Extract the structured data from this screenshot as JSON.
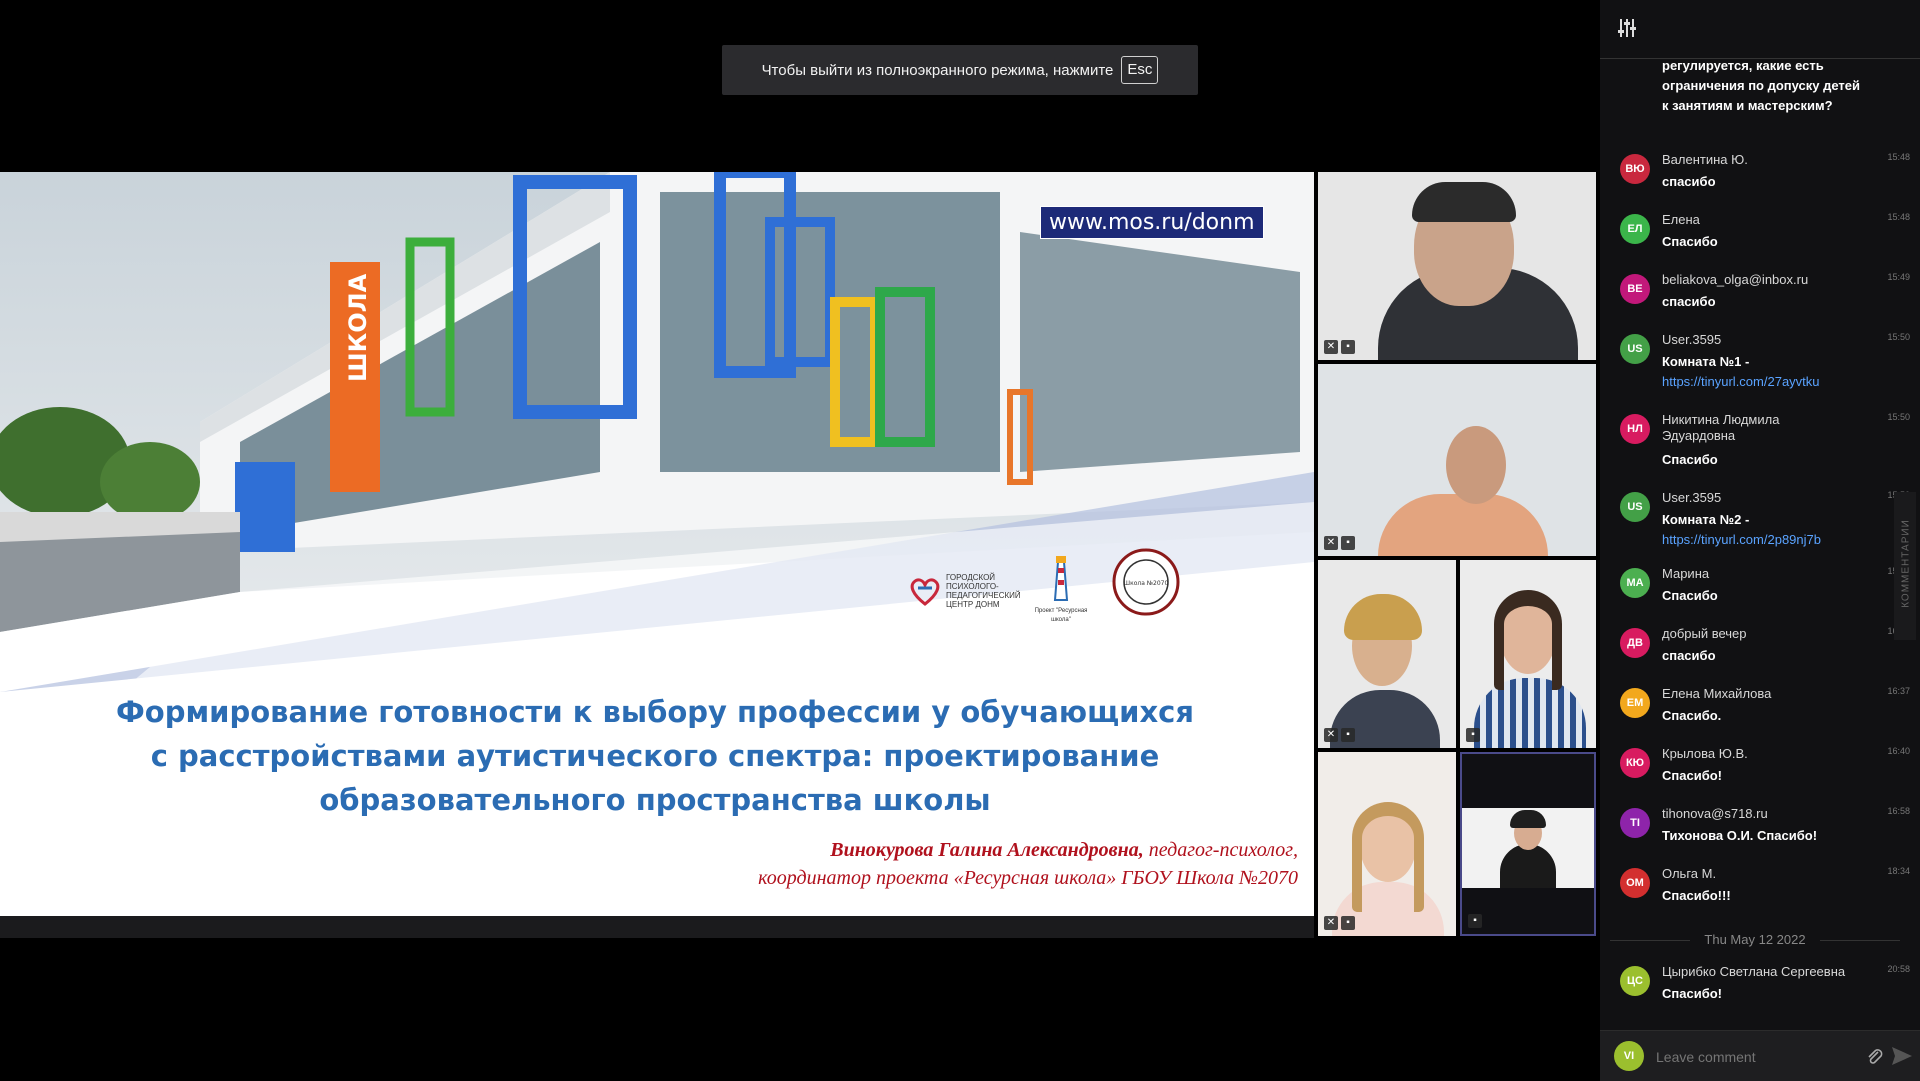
{
  "fullscreen_banner": {
    "text": "Чтобы выйти из полноэкранного режима, нажмите",
    "key": "Esc"
  },
  "slide": {
    "url": "www.mos.ru/donm",
    "title_lines": [
      "Формирование готовности к выбору профессии у обучающихся",
      "с расстройствами аутистического спектра: проектирование",
      "образовательного пространства школы"
    ],
    "author_name": "Винокурова Галина Александровна,",
    "author_role1": " педагог-психолог,",
    "author_role2": "координатор проекта «Ресурсная школа» ГБОУ Школа №2070",
    "building_sign": "ШКОЛА",
    "logo1_lines": [
      "ГОРОДСКОЙ",
      "ПСИХОЛОГО-",
      "ПЕДАГОГИЧЕСКИЙ",
      "ЦЕНТР ДОНМ"
    ],
    "logo2_text": "Проект \"Ресурсная школа\"",
    "logo3_text": "Школа №2070"
  },
  "chat": {
    "prev_message": "регулируется, какие есть ограничения по допуску детей к занятиям и мастерским?",
    "messages": [
      {
        "initials": "ВЮ",
        "author": "Валентина Ю.",
        "time": "15:48",
        "text": "спасибо",
        "color": "#c9283e"
      },
      {
        "initials": "ЕЛ",
        "author": "Елена",
        "time": "15:48",
        "text": "Спасибо",
        "color": "#3bb54a"
      },
      {
        "initials": "BE",
        "author": "beliakova_olga@inbox.ru",
        "time": "15:49",
        "text": "спасибо",
        "color": "#c2187a"
      },
      {
        "initials": "US",
        "author": "User.3595",
        "time": "15:50",
        "text": "Комната №1 -",
        "link": "https://tinyurl.com/27ayvtku",
        "color": "#43a047"
      },
      {
        "initials": "НЛ",
        "author": "Никитина Людмила Эдуардовна",
        "time": "15:50",
        "text": "Спасибо",
        "color": "#d81b60"
      },
      {
        "initials": "US",
        "author": "User.3595",
        "time": "15:50",
        "text": "Комната №2 -",
        "link": "https://tinyurl.com/2p89nj7b",
        "color": "#43a047"
      },
      {
        "initials": "МА",
        "author": "Марина",
        "time": "15:56",
        "text": "Спасибо",
        "color": "#4caf50"
      },
      {
        "initials": "ДВ",
        "author": "добрый вечер",
        "time": "16:12",
        "text": "спасибо",
        "color": "#d81b60"
      },
      {
        "initials": "ЕМ",
        "author": "Елена Михайлова",
        "time": "16:37",
        "text": "Спасибо.",
        "color": "#f2a81d"
      },
      {
        "initials": "КЮ",
        "author": "Крылова Ю.В.",
        "time": "16:40",
        "text": "Спасибо!",
        "color": "#d81b60"
      },
      {
        "initials": "TI",
        "author": "tihonova@s718.ru",
        "time": "16:58",
        "text": "Тихонова О.И. Спасибо!",
        "color": "#8e24aa"
      },
      {
        "initials": "ОМ",
        "author": "Ольга М.",
        "time": "18:34",
        "text": "Спасибо!!!",
        "color": "#d32f2f"
      },
      {
        "initials": "ЦС",
        "author": "Цырибко Светлана Сергеевна",
        "time": "20:58",
        "text": "Спасибо!",
        "color": "#9bbf2e"
      }
    ],
    "date_divider": "Thu May 12 2022",
    "side_tab": "КОММЕНТАРИИ",
    "input": {
      "avatar": "VI",
      "avatar_color": "#9bbf2e",
      "placeholder": "Leave comment"
    }
  },
  "icons": {
    "settings": "sliders-icon",
    "attach": "paperclip-icon",
    "send": "send-icon",
    "mic": "mic-muted-icon",
    "cam": "camera-icon"
  }
}
